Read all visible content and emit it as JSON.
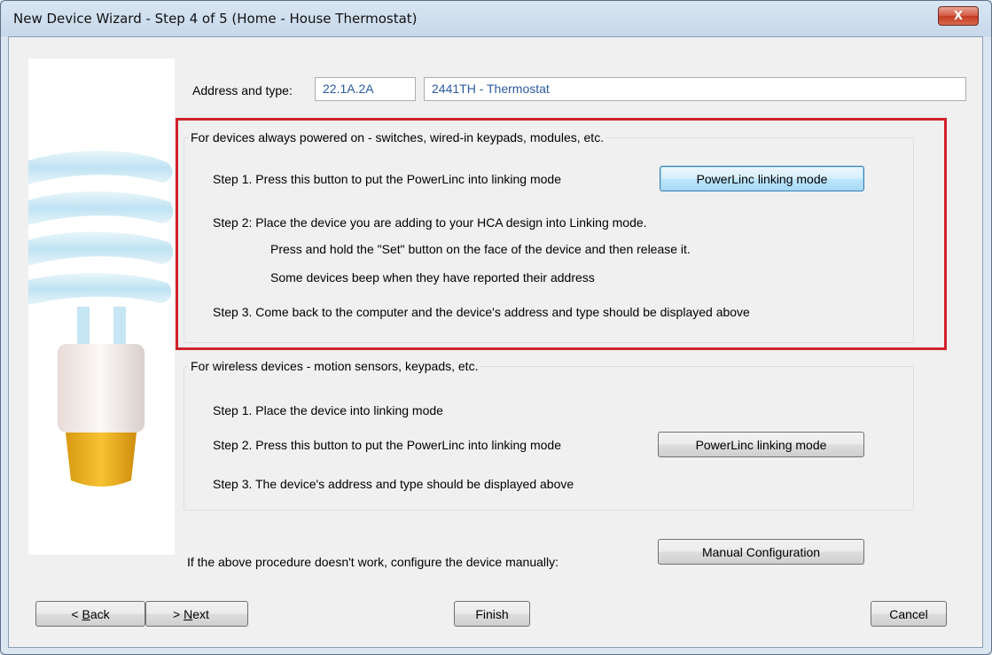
{
  "window": {
    "title": "New Device Wizard - Step 4 of 5 (Home - House Thermostat)",
    "close_glyph": "X"
  },
  "address": {
    "label": "Address and type:",
    "address_value": "22.1A.2A",
    "type_value": "2441TH - Thermostat"
  },
  "powered": {
    "title": "For devices always powered on - switches, wired-in keypads, modules, etc.",
    "step1": "Step 1. Press this button to put the PowerLinc into linking mode",
    "button": "PowerLinc linking mode",
    "step2": "Step 2:  Place the device you are adding to your HCA design into Linking mode.",
    "step2_line2": "Press and hold the \"Set\" button on the face of the device and then release it.",
    "step2_line3": "Some devices beep when they have reported their address",
    "step3": "Step 3. Come back to the computer and the device's address and type should be displayed above"
  },
  "wireless": {
    "title": "For wireless devices - motion sensors, keypads, etc.",
    "step1": "Step 1. Place the device into linking mode",
    "step2": "Step 2. Press this button to put the PowerLinc into linking mode",
    "button": "PowerLinc linking mode",
    "step3": "Step 3. The device's address and type should be displayed above"
  },
  "manual": {
    "text": "If the above procedure doesn't work, configure the device manually:",
    "button": "Manual Configuration"
  },
  "footer": {
    "back_prefix": "< ",
    "back_key": "B",
    "back_rest": "ack",
    "next_prefix": "> ",
    "next_key": "N",
    "next_rest": "ext",
    "finish": "Finish",
    "cancel": "Cancel"
  },
  "colors": {
    "highlight_border": "#d0222b",
    "address_text": "#2a5aa0"
  }
}
